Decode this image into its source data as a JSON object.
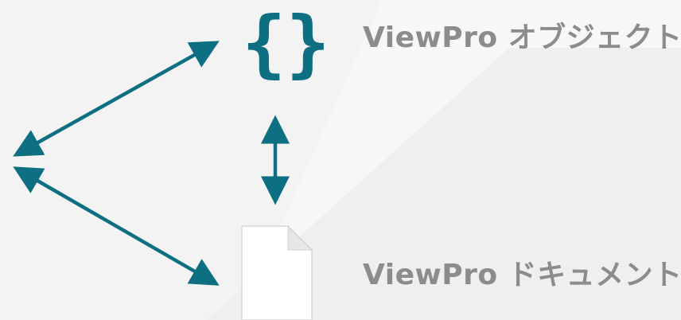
{
  "labels": {
    "object": "ViewPro オブジェクト",
    "document": "ViewPro ドキュメント"
  },
  "icons": {
    "object": "curly-braces-icon",
    "document": "blank-document-icon"
  },
  "colors": {
    "accent": "#0e6f82",
    "label": "#8c8c8c",
    "background": "#f7f7f7"
  }
}
